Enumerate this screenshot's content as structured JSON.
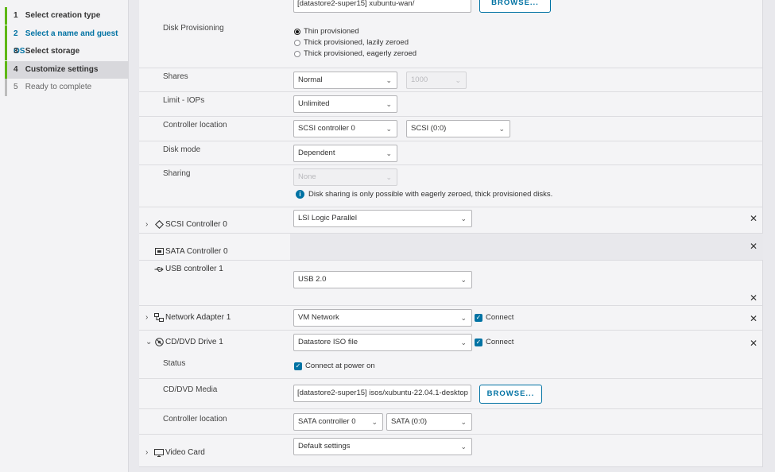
{
  "wizard": {
    "steps": [
      {
        "num": "1",
        "label": "Select creation type"
      },
      {
        "num": "2",
        "label": "Select a name and guest OS"
      },
      {
        "num": "3",
        "label": "Select storage"
      },
      {
        "num": "4",
        "label": "Customize settings"
      },
      {
        "num": "5",
        "label": "Ready to complete"
      }
    ]
  },
  "disk": {
    "file_value": "[datastore2-super15] xubuntu-wan/",
    "browse_label": "BROWSE...",
    "provisioning_label": "Disk Provisioning",
    "provisioning_options": [
      "Thin provisioned",
      "Thick provisioned, lazily zeroed",
      "Thick provisioned, eagerly zeroed"
    ],
    "shares_label": "Shares",
    "shares_value": "Normal",
    "shares_number": "1000",
    "limit_label": "Limit - IOPs",
    "limit_value": "Unlimited",
    "controller_label": "Controller location",
    "controller_value": "SCSI controller 0",
    "controller_slot": "SCSI (0:0)",
    "mode_label": "Disk mode",
    "mode_value": "Dependent",
    "sharing_label": "Sharing",
    "sharing_value": "None",
    "sharing_info": "Disk sharing is only possible with eagerly zeroed, thick provisioned disks."
  },
  "scsi": {
    "label": "SCSI Controller 0",
    "value": "LSI Logic Parallel"
  },
  "sata": {
    "label": "SATA Controller 0"
  },
  "usb": {
    "label": "USB controller 1",
    "value": "USB 2.0"
  },
  "network": {
    "label": "Network Adapter 1",
    "value": "VM Network",
    "connect_label": "Connect"
  },
  "cdrom": {
    "label": "CD/DVD Drive 1",
    "value": "Datastore ISO file",
    "connect_label": "Connect",
    "status_label": "Status",
    "status_value": "Connect at power on",
    "media_label": "CD/DVD Media",
    "media_value": "[datastore2-super15] isos/xubuntu-22.04.1-desktop",
    "browse_label": "BROWSE...",
    "controller_label": "Controller location",
    "controller_value": "SATA controller 0",
    "controller_slot": "SATA (0:0)"
  },
  "video": {
    "label": "Video Card",
    "value": "Default settings"
  },
  "icons": {
    "remove": "close-icon",
    "expand": "chevron-right-icon",
    "collapse": "chevron-down-icon"
  }
}
